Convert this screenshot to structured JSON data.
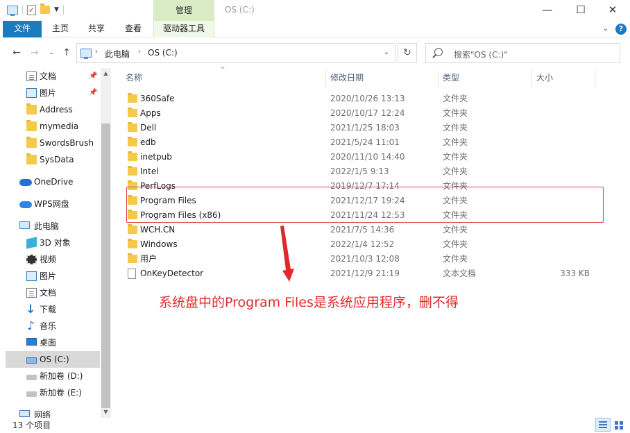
{
  "title_bar": {
    "context_tab": "管理",
    "window_title": "OS (C:)",
    "minimize": "—",
    "maximize": "☐",
    "close": "✕"
  },
  "ribbon": {
    "tabs": [
      "文件",
      "主页",
      "共享",
      "查看",
      "驱动器工具"
    ],
    "help": "?"
  },
  "address_bar": {
    "crumbs": [
      "此电脑",
      "OS (C:)"
    ],
    "search_placeholder": "搜索\"OS (C:)\""
  },
  "nav_pane": {
    "quick_access": [
      {
        "label": "文档",
        "icon": "documents-icon",
        "pinned": true
      },
      {
        "label": "图片",
        "icon": "pictures-icon",
        "pinned": true
      },
      {
        "label": "Address",
        "icon": "folder-icon",
        "pinned": false
      },
      {
        "label": "mymedia",
        "icon": "folder-icon",
        "pinned": false
      },
      {
        "label": "SwordsBrush",
        "icon": "folder-icon",
        "pinned": false
      },
      {
        "label": "SysData",
        "icon": "folder-icon",
        "pinned": false
      }
    ],
    "onedrive": "OneDrive",
    "wps": "WPS网盘",
    "this_pc": "此电脑",
    "this_pc_items": [
      {
        "label": "3D 对象",
        "icon": "3d-objects-icon"
      },
      {
        "label": "视频",
        "icon": "videos-icon"
      },
      {
        "label": "图片",
        "icon": "pictures-icon"
      },
      {
        "label": "文档",
        "icon": "documents-icon"
      },
      {
        "label": "下载",
        "icon": "downloads-icon"
      },
      {
        "label": "音乐",
        "icon": "music-icon"
      },
      {
        "label": "桌面",
        "icon": "desktop-icon"
      },
      {
        "label": "OS (C:)",
        "icon": "os-drive-icon",
        "selected": true
      },
      {
        "label": "新加卷 (D:)",
        "icon": "drive-icon"
      },
      {
        "label": "新加卷 (E:)",
        "icon": "drive-icon"
      }
    ],
    "network": "网络"
  },
  "columns": {
    "name": "名称",
    "date": "修改日期",
    "type": "类型",
    "size": "大小"
  },
  "files": [
    {
      "name": "360Safe",
      "date": "2020/10/26 13:13",
      "type": "文件夹",
      "size": "",
      "kind": "folder"
    },
    {
      "name": "Apps",
      "date": "2020/10/17 12:24",
      "type": "文件夹",
      "size": "",
      "kind": "folder"
    },
    {
      "name": "Dell",
      "date": "2021/1/25 18:03",
      "type": "文件夹",
      "size": "",
      "kind": "folder"
    },
    {
      "name": "edb",
      "date": "2021/5/24 11:01",
      "type": "文件夹",
      "size": "",
      "kind": "folder"
    },
    {
      "name": "inetpub",
      "date": "2020/11/10 14:40",
      "type": "文件夹",
      "size": "",
      "kind": "folder"
    },
    {
      "name": "Intel",
      "date": "2022/1/5 9:13",
      "type": "文件夹",
      "size": "",
      "kind": "folder"
    },
    {
      "name": "PerfLogs",
      "date": "2019/12/7 17:14",
      "type": "文件夹",
      "size": "",
      "kind": "folder"
    },
    {
      "name": "Program Files",
      "date": "2021/12/17 19:24",
      "type": "文件夹",
      "size": "",
      "kind": "folder"
    },
    {
      "name": "Program Files (x86)",
      "date": "2021/11/24 12:53",
      "type": "文件夹",
      "size": "",
      "kind": "folder"
    },
    {
      "name": "WCH.CN",
      "date": "2021/7/5 14:36",
      "type": "文件夹",
      "size": "",
      "kind": "folder"
    },
    {
      "name": "Windows",
      "date": "2022/1/4 12:52",
      "type": "文件夹",
      "size": "",
      "kind": "folder"
    },
    {
      "name": "用户",
      "date": "2021/10/3 12:08",
      "type": "文件夹",
      "size": "",
      "kind": "folder"
    },
    {
      "name": "OnKeyDetector",
      "date": "2021/12/9 21:19",
      "type": "文本文档",
      "size": "333 KB",
      "kind": "file"
    }
  ],
  "annotation": "系统盘中的Program Files是系统应用程序，删不得",
  "status_bar": {
    "item_count": "13 个项目"
  },
  "colors": {
    "accent": "#1a7bbf",
    "context_tab": "#d9ecc3",
    "annotation": "#e02a2a"
  }
}
